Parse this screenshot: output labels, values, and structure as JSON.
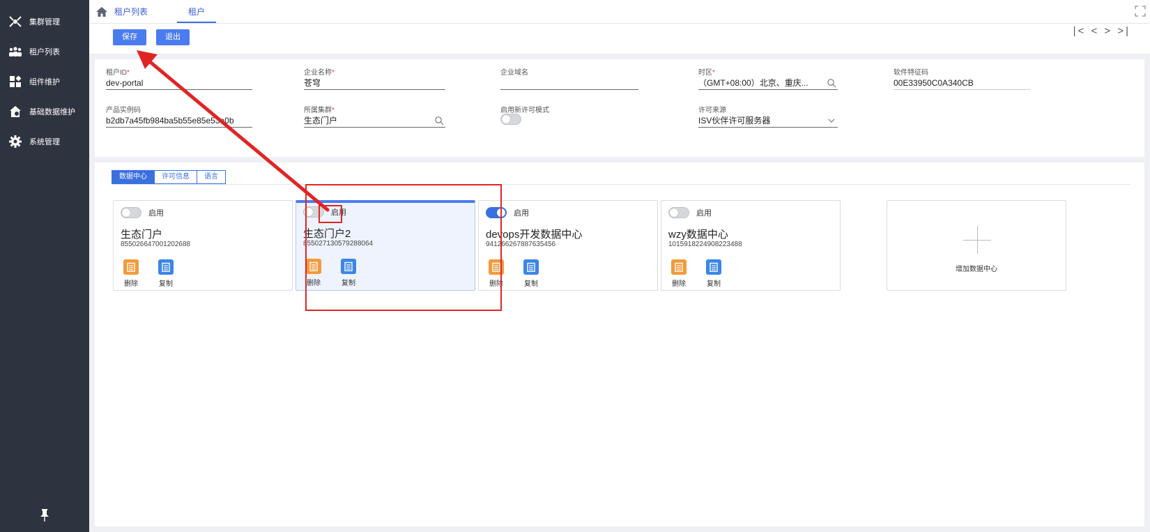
{
  "sidebar": {
    "items": [
      {
        "label": "集群管理",
        "icon": "cluster-icon"
      },
      {
        "label": "租户列表",
        "icon": "users-icon"
      },
      {
        "label": "组件维护",
        "icon": "components-icon"
      },
      {
        "label": "基础数据维护",
        "icon": "house-data-icon"
      },
      {
        "label": "系统管理",
        "icon": "gear-icon"
      }
    ],
    "pin_icon": "pin-icon"
  },
  "topbar": {
    "tabs": [
      {
        "label": "租户列表"
      },
      {
        "label": "租户",
        "active": true
      }
    ]
  },
  "actions": {
    "save_label": "保存",
    "exit_label": "退出",
    "pager": {
      "first": "|<",
      "prev": "<",
      "next": ">",
      "last": ">|"
    }
  },
  "form": {
    "tenant_id": {
      "label": "租户ID",
      "required": "*",
      "value": "dev-portal"
    },
    "company_name": {
      "label": "企业名称",
      "required": "*",
      "value": "苍穹"
    },
    "company_domain": {
      "label": "企业域名",
      "value": ""
    },
    "timezone": {
      "label": "时区",
      "required": "*",
      "value": "（GMT+08:00）北京、重庆..."
    },
    "software_code": {
      "label": "软件特征码",
      "value": "00E33950C0A340CB"
    },
    "product_instance": {
      "label": "产品实例码",
      "value": "b2db7a45fb984ba5b55e85e53a0b"
    },
    "cluster": {
      "label": "所属集群",
      "required": "*",
      "value": "生态门户"
    },
    "new_license_mode": {
      "label": "启用新许可模式",
      "enabled": false
    },
    "license_source": {
      "label": "许可来源",
      "value": "ISV伙伴许可服务器"
    }
  },
  "subtabs": [
    {
      "label": "数据中心",
      "active": true
    },
    {
      "label": "许可信息"
    },
    {
      "label": "语言"
    }
  ],
  "datacenters": [
    {
      "enable_label": "启用",
      "enabled": false,
      "name": "生态门户",
      "id": "855026647001202688",
      "delete_label": "删除",
      "copy_label": "复制"
    },
    {
      "enable_label": "启用",
      "enabled": false,
      "name": "生态门户2",
      "id": "855027130579288064",
      "delete_label": "删除",
      "copy_label": "复制",
      "selected": true
    },
    {
      "enable_label": "启用",
      "enabled": true,
      "name": "devops开发数据中心",
      "id": "941266267887635456",
      "delete_label": "删除",
      "copy_label": "复制"
    },
    {
      "enable_label": "启用",
      "enabled": false,
      "name": "wzy数据中心",
      "id": "1015918224908223488",
      "delete_label": "删除",
      "copy_label": "复制"
    }
  ],
  "add_datacenter_label": "增加数据中心",
  "colors": {
    "accent": "#4a7cf0",
    "sidebar": "#2e3340",
    "annotation": "#e02424",
    "delete": "#f39a3c",
    "copy": "#3b86e6"
  }
}
